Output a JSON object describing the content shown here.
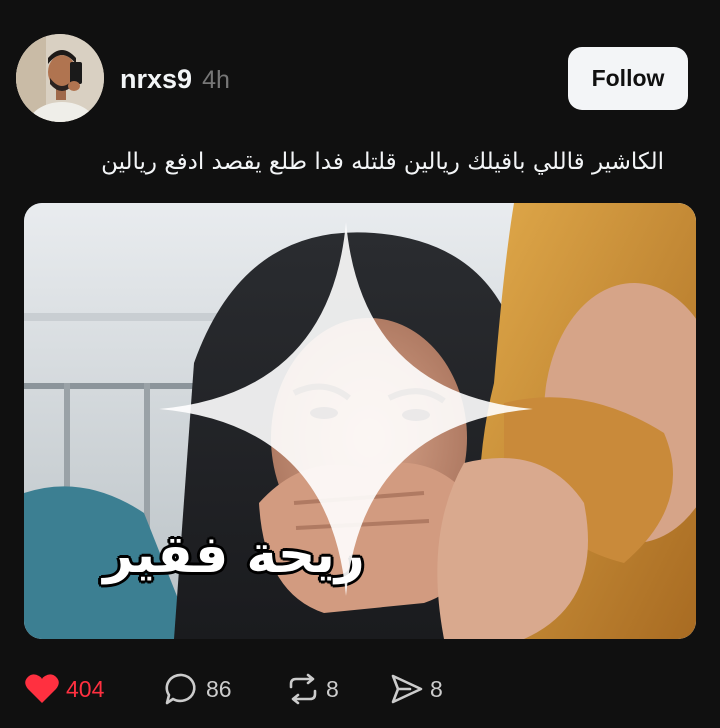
{
  "post": {
    "username": "nrxs9",
    "timestamp": "4h",
    "follow_label": "Follow",
    "caption": "الكاشير قاللي باقيلك ريالين قلتله فدا طلع يقصد ادفع ريالين",
    "media": {
      "overlay_text": "ريحة فقير"
    }
  },
  "actions": {
    "likes": "404",
    "replies": "86",
    "reposts": "8",
    "shares": "8"
  },
  "colors": {
    "background": "#101010",
    "text_primary": "#f3f5f7",
    "text_secondary": "#777777",
    "like_active": "#ff3040",
    "button_bg": "#f3f5f7"
  }
}
